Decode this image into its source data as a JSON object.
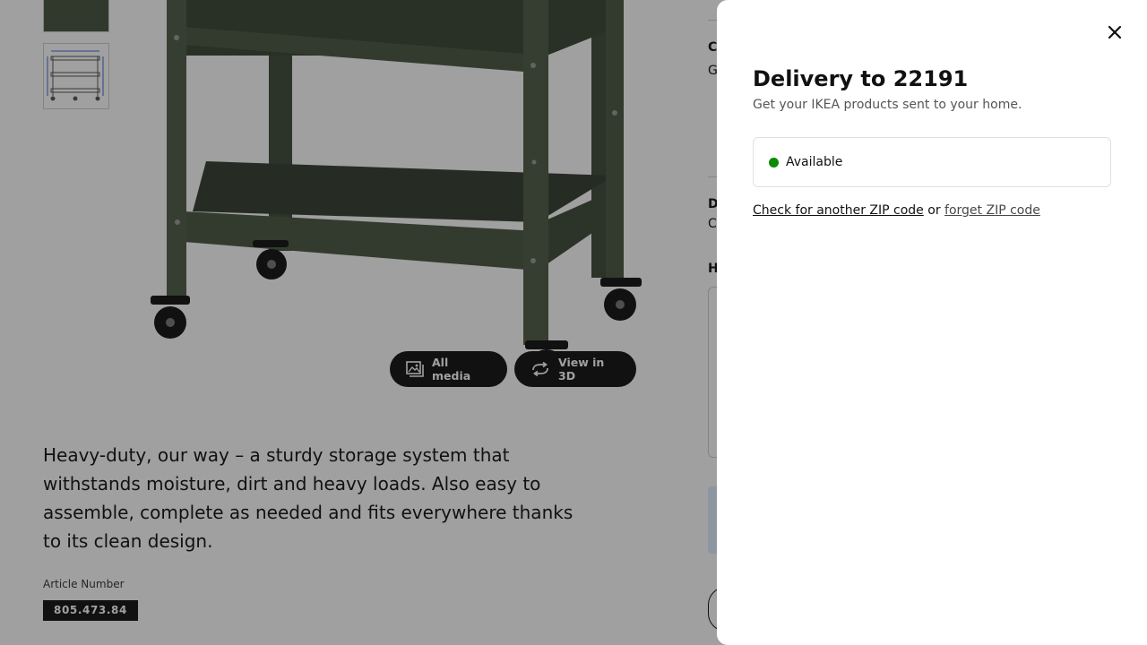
{
  "product": {
    "media_buttons": {
      "all_media": "All media",
      "view_3d": "View in 3D"
    },
    "description": "Heavy-duty, our way – a sturdy storage system that withstands moisture, dirt and heavy loads. Also easy to assemble, complete as needed and fits everywhere thanks to its clean design.",
    "article_label": "Article Number",
    "article_number": "805.473.84",
    "color_accent": "#46543f"
  },
  "side_column": {
    "letters": [
      "C",
      "G",
      "D",
      "C",
      "H"
    ]
  },
  "delivery_sheet": {
    "title": "Delivery to 22191",
    "subtitle": "Get your IKEA products sent to your home.",
    "availability": {
      "status": "Available",
      "status_color": "#0a8a00"
    },
    "check_another_zip": "Check for another ZIP code",
    "or_text": "or",
    "forget_zip": "forget ZIP code",
    "close_icon": "close-icon"
  }
}
